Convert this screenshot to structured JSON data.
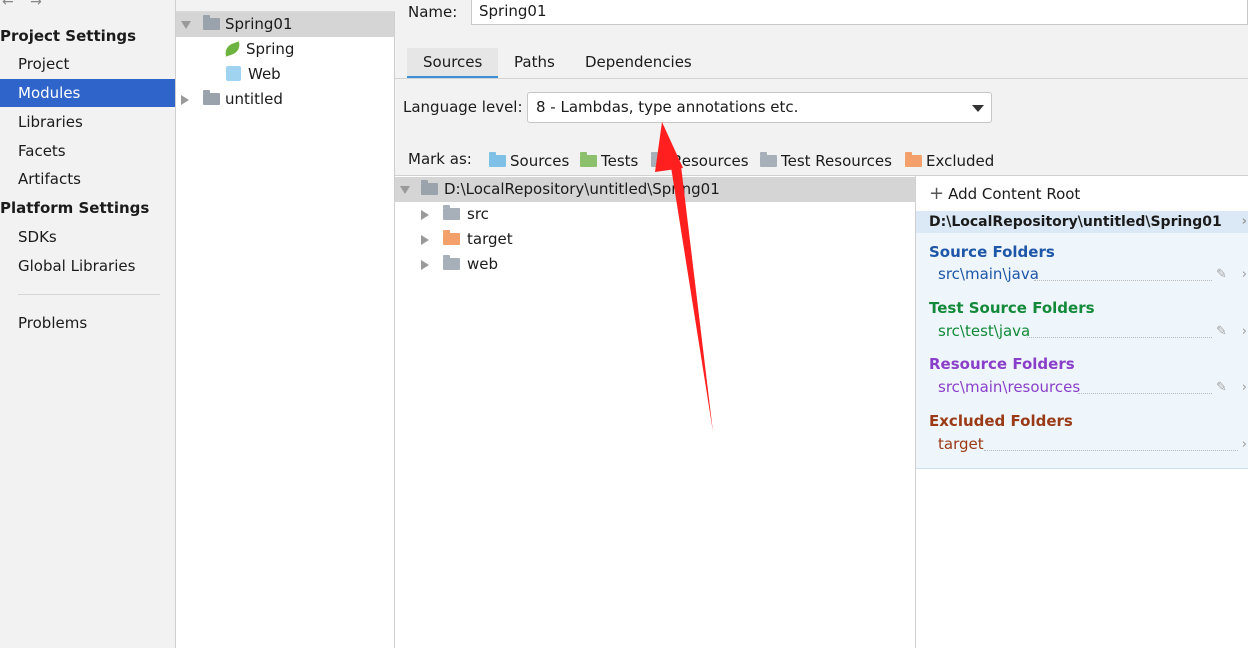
{
  "nav": {
    "project_settings_header": "Project Settings",
    "project_items": [
      "Project",
      "Modules",
      "Libraries",
      "Facets",
      "Artifacts"
    ],
    "platform_settings_header": "Platform Settings",
    "platform_items": [
      "SDKs",
      "Global Libraries"
    ],
    "problems": "Problems",
    "selected": "Modules"
  },
  "module_tree": {
    "module": "Spring01",
    "facets": [
      "Spring",
      "Web"
    ],
    "other_module": "untitled"
  },
  "main": {
    "name_label": "Name:",
    "name_value": "Spring01",
    "tabs": [
      "Sources",
      "Paths",
      "Dependencies"
    ],
    "active_tab": "Sources",
    "language_level_label": "Language level:",
    "language_level_value": "8 - Lambdas, type annotations etc.",
    "mark_as_label": "Mark as:",
    "mark_as": [
      "Sources",
      "Tests",
      "Resources",
      "Test Resources",
      "Excluded"
    ]
  },
  "content_tree": {
    "root": "D:\\LocalRepository\\untitled\\Spring01",
    "children": [
      "src",
      "target",
      "web"
    ]
  },
  "content_roots": {
    "add_label": "Add Content Root",
    "root_path": "D:\\LocalRepository\\untitled\\Spring01",
    "groups": [
      {
        "title": "Source Folders",
        "item": "src\\main\\java",
        "color": "#1e56a8"
      },
      {
        "title": "Test Source Folders",
        "item": "src\\test\\java",
        "color": "#128a3a"
      },
      {
        "title": "Resource Folders",
        "item": "src\\main\\resources",
        "color": "#8a3fc9"
      },
      {
        "title": "Excluded Folders",
        "item": "target",
        "color": "#9a3a16"
      }
    ]
  },
  "colors": {
    "selection_blue": "#2f65ca",
    "annotation_arrow": "#ff1f1f"
  }
}
